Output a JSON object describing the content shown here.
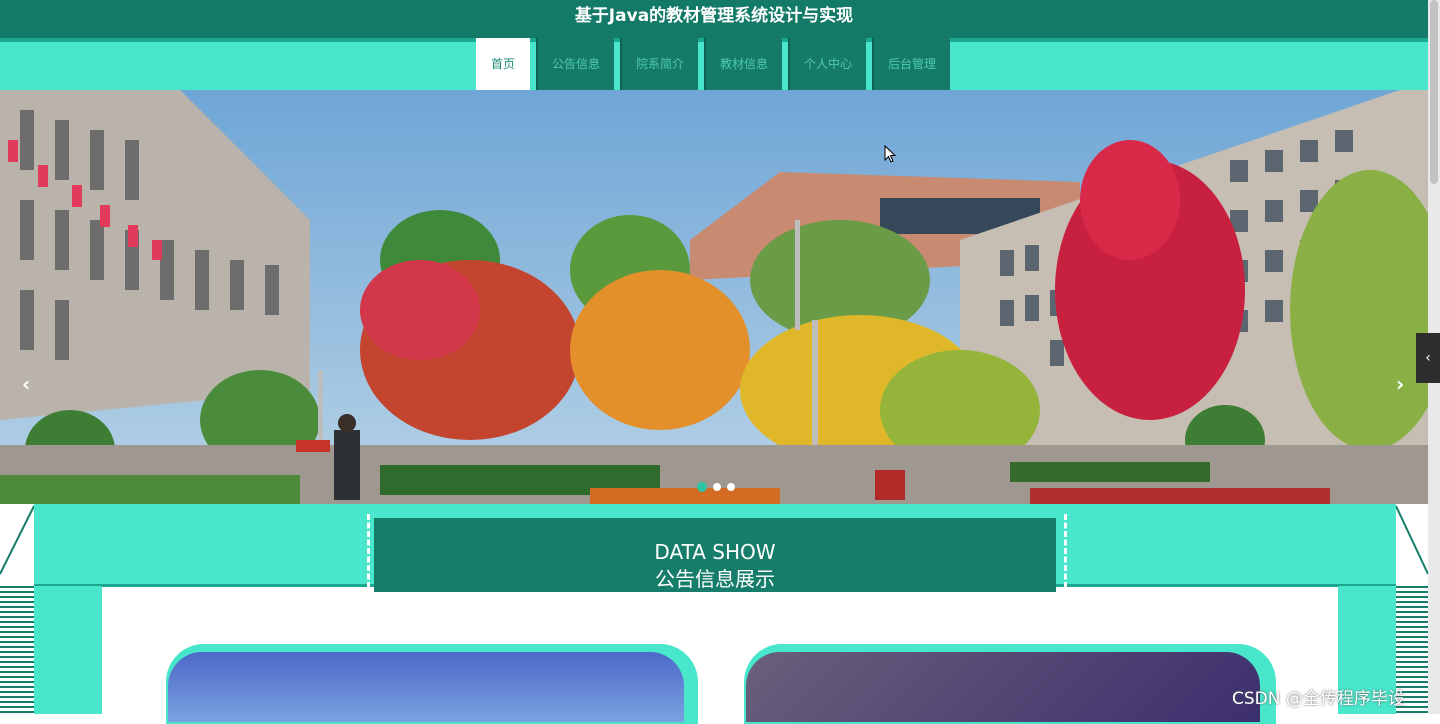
{
  "header": {
    "title": "基于Java的教材管理系统设计与实现"
  },
  "nav": {
    "items": [
      {
        "label": "首页",
        "active": true
      },
      {
        "label": "公告信息",
        "active": false
      },
      {
        "label": "院系简介",
        "active": false
      },
      {
        "label": "教材信息",
        "active": false
      },
      {
        "label": "个人中心",
        "active": false
      },
      {
        "label": "后台管理",
        "active": false
      }
    ]
  },
  "banner": {
    "prev_icon": "‹",
    "next_icon": "›",
    "slide_count": 3,
    "active_slide": 1
  },
  "side_tab": {
    "icon": "‹"
  },
  "section": {
    "title_en": "DATA SHOW",
    "title_zh": "公告信息展示"
  },
  "watermark": "CSDN @全传程序毕设",
  "colors": {
    "title_bar": "#127a66",
    "nav_band": "#48e6cb",
    "nav_item": "#157a68",
    "accent": "#2ec4a6"
  }
}
